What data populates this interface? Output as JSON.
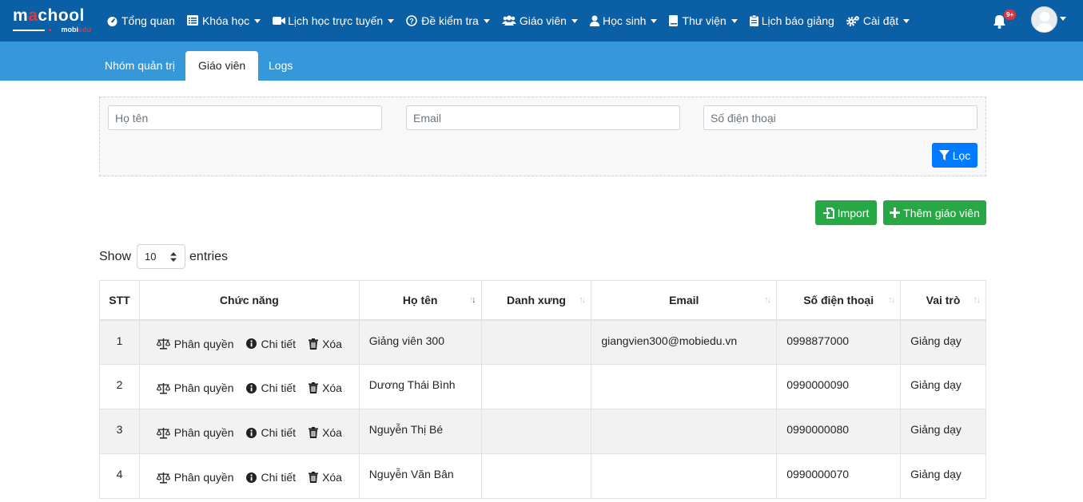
{
  "brand": {
    "logo_main_a": "m",
    "logo_main_o": "a",
    "logo_main_b": "chool",
    "logo_sub_a": "mobi",
    "logo_sub_b": "edu"
  },
  "nav": [
    {
      "label": "Tổng quan",
      "icon": "dashboard-icon",
      "dropdown": false
    },
    {
      "label": "Khóa học",
      "icon": "list-icon",
      "dropdown": true
    },
    {
      "label": "Lịch học trực tuyến",
      "icon": "video-icon",
      "dropdown": true
    },
    {
      "label": "Đề kiểm tra",
      "icon": "question-circle-icon",
      "dropdown": true
    },
    {
      "label": "Giáo viên",
      "icon": "users-icon",
      "dropdown": true
    },
    {
      "label": "Học sinh",
      "icon": "user-icon",
      "dropdown": true
    },
    {
      "label": "Thư viện",
      "icon": "book-icon",
      "dropdown": true
    },
    {
      "label": "Lịch báo giảng",
      "icon": "clipboard-icon",
      "dropdown": false
    },
    {
      "label": "Cài đặt",
      "icon": "cogs-icon",
      "dropdown": true
    }
  ],
  "notifications": {
    "badge": "9+"
  },
  "tabs": [
    {
      "label": "Nhóm quản trị",
      "active": false
    },
    {
      "label": "Giáo viên",
      "active": true
    },
    {
      "label": "Logs",
      "active": false
    }
  ],
  "filter": {
    "name_placeholder": "Họ tên",
    "email_placeholder": "Email",
    "phone_placeholder": "Số điện thoại",
    "filter_button": "Lọc"
  },
  "buttons": {
    "import": "Import",
    "add_teacher": "Thêm giáo viên"
  },
  "entries": {
    "show": "Show",
    "value": "10",
    "suffix": "entries"
  },
  "table": {
    "headers": [
      "STT",
      "Chức năng",
      "Họ tên",
      "Danh xưng",
      "Email",
      "Số điện thoại",
      "Vai trò"
    ],
    "actions": {
      "permission": "Phân quyền",
      "detail": "Chi tiết",
      "delete": "Xóa"
    },
    "rows": [
      {
        "stt": "1",
        "name": "Giảng viên 300",
        "title": "",
        "email": "giangvien300@mobiedu.vn",
        "phone": "0998877000",
        "role": "Giảng dạy"
      },
      {
        "stt": "2",
        "name": "Dương Thái Bình",
        "title": "",
        "email": "",
        "phone": "0990000090",
        "role": "Giảng dạy"
      },
      {
        "stt": "3",
        "name": "Nguyễn Thị Bé",
        "title": "",
        "email": "",
        "phone": "0990000080",
        "role": "Giảng dạy"
      },
      {
        "stt": "4",
        "name": "Nguyễn Văn Bân",
        "title": "",
        "email": "",
        "phone": "0990000070",
        "role": "Giảng dạy"
      }
    ]
  },
  "colors": {
    "navbar": "#0a5fa5",
    "subbar": "#3498db",
    "primary": "#007bff",
    "success": "#28a745",
    "danger": "#dc3545"
  }
}
